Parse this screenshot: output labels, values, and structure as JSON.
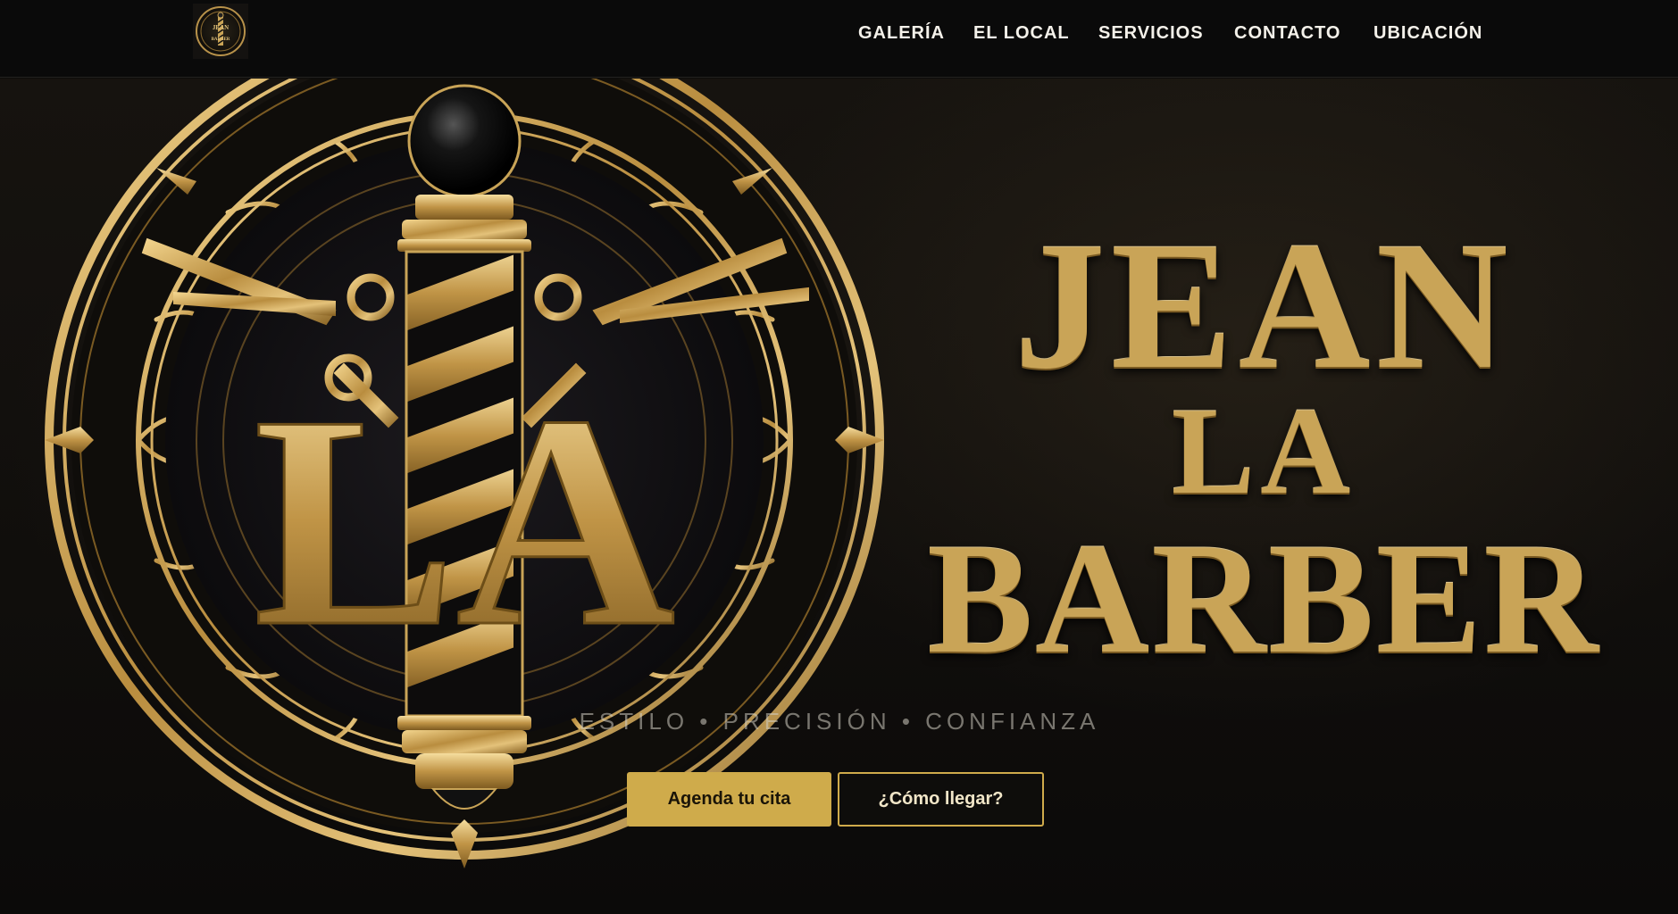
{
  "header": {
    "logo_alt": "JEAN LA BARBER",
    "logo_text_top": "JEAN",
    "logo_text_bottom": "BARBER",
    "nav": [
      {
        "label": "GALERÍA"
      },
      {
        "label": "EL LOCAL"
      },
      {
        "label": "SERVICIOS"
      },
      {
        "label": "CONTACTO"
      },
      {
        "label": "UBICACIÓN"
      }
    ]
  },
  "hero": {
    "emblem_letters": "LA",
    "title_line1": "JEAN",
    "title_line2": "LA",
    "title_line3": "BARBER",
    "tagline": "ESTILO • PRECISIÓN • CONFIANZA",
    "cta_primary": "Agenda tu cita",
    "cta_secondary": "¿Cómo llegar?"
  },
  "colors": {
    "gold": "#cfab4b",
    "background": "#0d0c0b",
    "nav_text": "#f4f1ea"
  },
  "icons": {
    "logo": "barber-pole-emblem-icon",
    "emblem": "barber-pole-scissors-emblem-icon"
  }
}
